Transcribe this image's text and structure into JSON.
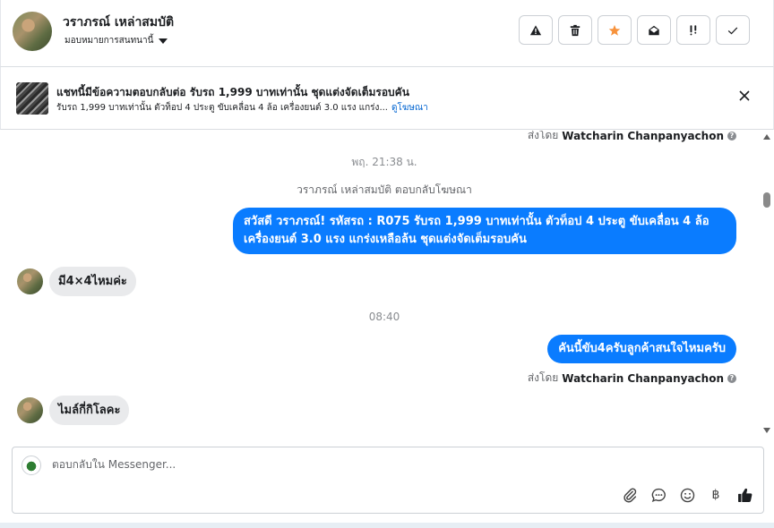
{
  "header": {
    "contact_name": "วราภรณ์ เหล่าสมบัติ",
    "assign_label": "มอบหมายการสนทนานี้",
    "actions": [
      {
        "name": "mark-spam-button",
        "icon": "warning-icon"
      },
      {
        "name": "delete-button",
        "icon": "trash-icon"
      },
      {
        "name": "star-button",
        "icon": "star-icon"
      },
      {
        "name": "mark-unread-button",
        "icon": "envelope-open-icon"
      },
      {
        "name": "follow-up-button",
        "icon": "priority-icon"
      },
      {
        "name": "mark-done-button",
        "icon": "checkmark-icon"
      }
    ],
    "star_color": "#f7923b"
  },
  "banner": {
    "title": "แชทนี้มีข้อความตอบกลับต่อ รับรถ 1,999 บาทเท่านั้น ชุดแต่งจัดเต็มรอบคัน",
    "subtitle": "รับรถ 1,999 บาทเท่านั้น ตัวท็อป 4 ประตู ขับเคลื่อน 4 ล้อ เครื่องยนต์ 3.0 แรง แกร่ง...",
    "link": "ดูโฆษณา"
  },
  "messages": {
    "sentby_top": {
      "prefix": "ส่งโดย",
      "name": "Watcharin Chanpanyachon"
    },
    "timestamp_1": "พฤ. 21:38 น.",
    "system_note": "วราภรณ์ เหล่าสมบัติ ตอบกลับโฆษณา",
    "outgoing_1": "สวัสดี วราภรณ์! รหัสรถ : R075 รับรถ 1,999 บาทเท่านั้น ตัวท็อป 4 ประตู ขับเคลื่อน 4 ล้อ เครื่องยนต์ 3.0 แรง แกร่งเหลือล้น ชุดแต่งจัดเต็มรอบคัน",
    "incoming_1": "มี4×4ไหมค่ะ",
    "timestamp_2": "08:40",
    "outgoing_2": "คันนี้ขับ4ครับลูกค้าสนใจไหมครับ",
    "sentby_bottom": {
      "prefix": "ส่งโดย",
      "name": "Watcharin Chanpanyachon"
    },
    "incoming_2": "ไมล์กี่กิโลคะ"
  },
  "composer": {
    "placeholder": "ตอบกลับใน Messenger...",
    "tools": [
      "paperclip-icon",
      "chat-bubble-icon",
      "smiley-icon",
      "baht-icon",
      "thumbs-up-icon"
    ],
    "baht_symbol": "฿"
  },
  "colors": {
    "accent": "#0a7cff",
    "incoming_bubble": "#e9eaec",
    "link": "#0064d1"
  }
}
